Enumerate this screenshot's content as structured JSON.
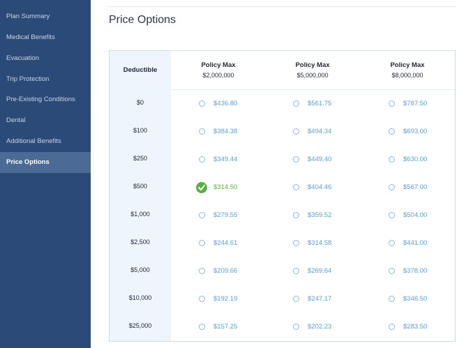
{
  "sidebar": {
    "items": [
      {
        "label": "Plan Summary"
      },
      {
        "label": "Medical Benefits"
      },
      {
        "label": "Evacuation"
      },
      {
        "label": "Trip Protection"
      },
      {
        "label": "Pre-Existing Conditions"
      },
      {
        "label": "Dental"
      },
      {
        "label": "Additional Benefits"
      },
      {
        "label": "Price Options",
        "active": true
      }
    ]
  },
  "page": {
    "title": "Price Options"
  },
  "table": {
    "deductible_header": "Deductible",
    "columns": [
      {
        "title": "Policy Max",
        "amount": "$2,000,000"
      },
      {
        "title": "Policy Max",
        "amount": "$5,000,000"
      },
      {
        "title": "Policy Max",
        "amount": "$8,000,000"
      }
    ],
    "rows": [
      {
        "deductible": "$0",
        "prices": [
          "$436.80",
          "$561.75",
          "$787.50"
        ]
      },
      {
        "deductible": "$100",
        "prices": [
          "$384.38",
          "$494.34",
          "$693.00"
        ]
      },
      {
        "deductible": "$250",
        "prices": [
          "$349.44",
          "$449.40",
          "$630.00"
        ]
      },
      {
        "deductible": "$500",
        "prices": [
          "$314.50",
          "$404.46",
          "$567.00"
        ]
      },
      {
        "deductible": "$1,000",
        "prices": [
          "$279.55",
          "$359.52",
          "$504.00"
        ]
      },
      {
        "deductible": "$2,500",
        "prices": [
          "$244.61",
          "$314.58",
          "$441.00"
        ]
      },
      {
        "deductible": "$5,000",
        "prices": [
          "$209.66",
          "$269.64",
          "$378.00"
        ]
      },
      {
        "deductible": "$10,000",
        "prices": [
          "$192.19",
          "$247.17",
          "$346.50"
        ]
      },
      {
        "deductible": "$25,000",
        "prices": [
          "$157.25",
          "$202.23",
          "$283.50"
        ]
      }
    ],
    "selected": {
      "row": 3,
      "col": 0
    }
  },
  "colors": {
    "sidebar_bg": "#2c4a77",
    "sidebar_active": "#4c6a96",
    "price_link": "#5a9fd4",
    "selected_green": "#5cb043"
  }
}
